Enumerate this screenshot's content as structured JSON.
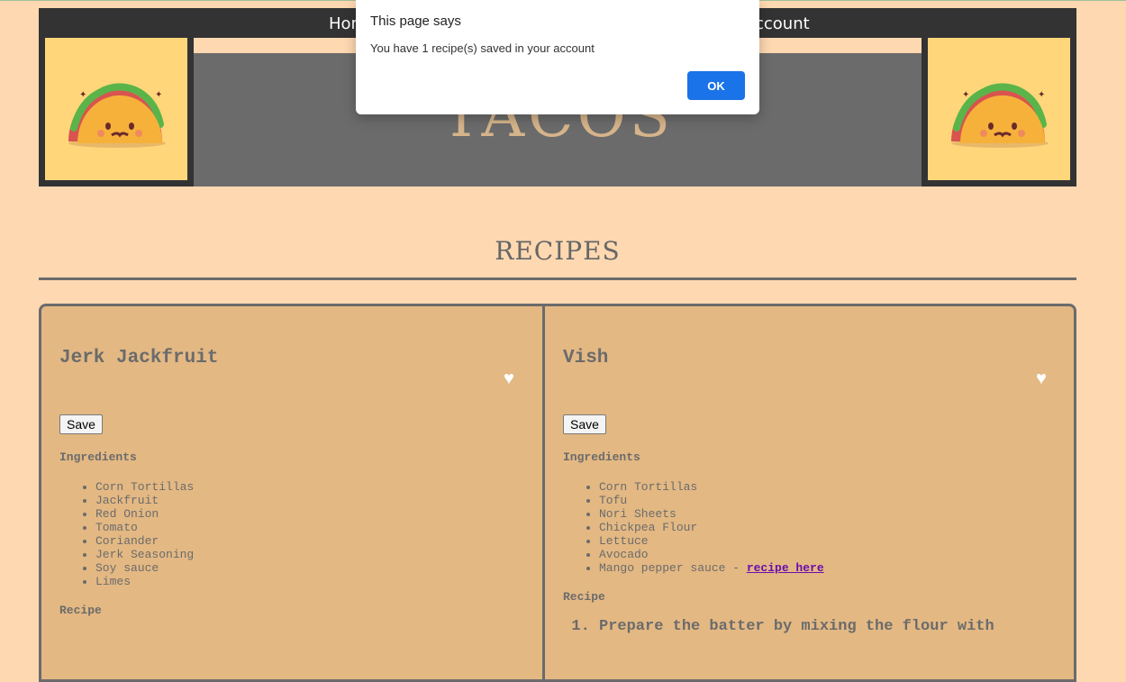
{
  "nav": {
    "home": "Home",
    "account": "Account"
  },
  "banner": {
    "title": "TACOS"
  },
  "dialog": {
    "title": "This page says",
    "message": "You have 1 recipe(s) saved in your account",
    "ok_label": "OK"
  },
  "section": {
    "title": "RECIPES"
  },
  "recipes": [
    {
      "title": "Jerk Jackfruit",
      "heart_icon": "white-heart-icon",
      "save_label": "Save",
      "ingredients_label": "Ingredients",
      "ingredients": [
        "Corn Tortillas",
        "Jackfruit",
        "Red Onion",
        "Tomato",
        "Coriander",
        "Jerk Seasoning",
        "Soy sauce",
        "Limes"
      ],
      "recipe_label": "Recipe"
    },
    {
      "title": "Vish",
      "heart_icon": "white-heart-icon",
      "save_label": "Save",
      "ingredients_label": "Ingredients",
      "ingredients": [
        "Corn Tortillas",
        "Tofu",
        "Nori Sheets",
        "Chickpea Flour",
        "Lettuce",
        "Avocado",
        "Mango pepper sauce - "
      ],
      "ingredient_link": "recipe here",
      "recipe_label": "Recipe",
      "first_step": "Prepare the batter by mixing the flour with"
    }
  ],
  "colors": {
    "background": "#fed8b1",
    "header": "#333333",
    "card": "#e3b883",
    "border": "#6b6b6b",
    "dialog_button": "#1a73e8"
  }
}
